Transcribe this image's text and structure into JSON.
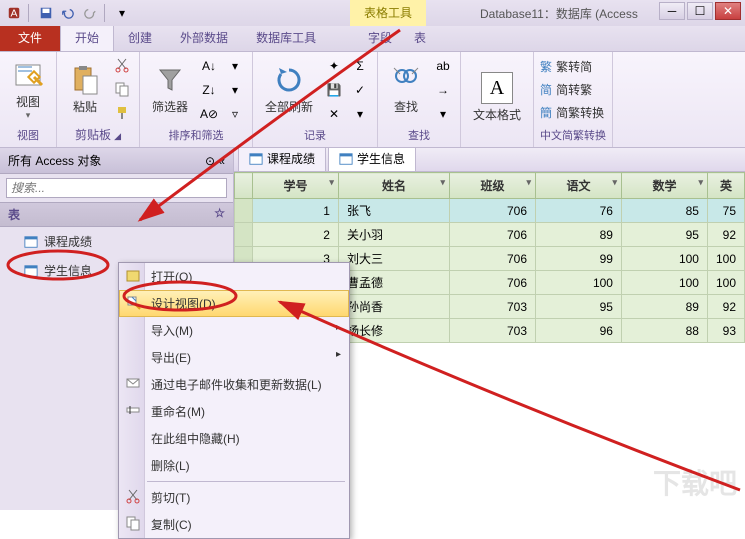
{
  "titlebar": {
    "table_tools": "表格工具",
    "title": "Database11：数据库 (Access"
  },
  "tabs": {
    "file": "文件",
    "start": "开始",
    "create": "创建",
    "external": "外部数据",
    "dbtools": "数据库工具",
    "field": "字段",
    "table": "表"
  },
  "ribbon": {
    "view": "视图",
    "paste": "粘贴",
    "clipboard": "剪贴板",
    "filter": "筛选器",
    "sortfilter": "排序和筛选",
    "refresh": "全部刷新",
    "records": "记录",
    "find": "查找",
    "textformat": "文本格式",
    "simp2trad": "繁转简",
    "trad2simp": "简转繁",
    "simptrad": "简繁转换",
    "convert_group": "中文简繁转换"
  },
  "nav": {
    "header": "所有 Access 对象",
    "search_ph": "搜索...",
    "group_tables": "表",
    "items": [
      "课程成绩",
      "学生信息"
    ]
  },
  "datasheet": {
    "tabs": [
      "课程成绩",
      "学生信息"
    ],
    "columns": [
      "学号",
      "姓名",
      "班级",
      "语文",
      "数学"
    ],
    "last_col": "英",
    "rows": [
      {
        "id": 1,
        "name": "张飞",
        "class": 706,
        "yuwen": 76,
        "shuxue": 85,
        "ying": 75,
        "sel": true
      },
      {
        "id": 2,
        "name": "关小羽",
        "class": 706,
        "yuwen": 89,
        "shuxue": 95,
        "ying": 92,
        "sel": false
      },
      {
        "id": 3,
        "name": "刘大三",
        "class": 706,
        "yuwen": 99,
        "shuxue": 100,
        "ying": 100,
        "sel": false
      },
      {
        "id": null,
        "name": "曹孟德",
        "class": 706,
        "yuwen": 100,
        "shuxue": 100,
        "ying": 100,
        "sel": false
      },
      {
        "id": null,
        "name": "孙尚香",
        "class": 703,
        "yuwen": 95,
        "shuxue": 89,
        "ying": 92,
        "sel": false
      },
      {
        "id": null,
        "name": "杨长修",
        "class": 703,
        "yuwen": 96,
        "shuxue": 88,
        "ying": 93,
        "sel": false
      }
    ]
  },
  "context_menu": {
    "open": "打开(O)",
    "design": "设计视图(D)",
    "import": "导入(M)",
    "export": "导出(E)",
    "email": "通过电子邮件收集和更新数据(L)",
    "rename": "重命名(M)",
    "hide": "在此组中隐藏(H)",
    "delete": "删除(L)",
    "cut": "剪切(T)",
    "copy": "复制(C)"
  },
  "watermark": "下载吧"
}
